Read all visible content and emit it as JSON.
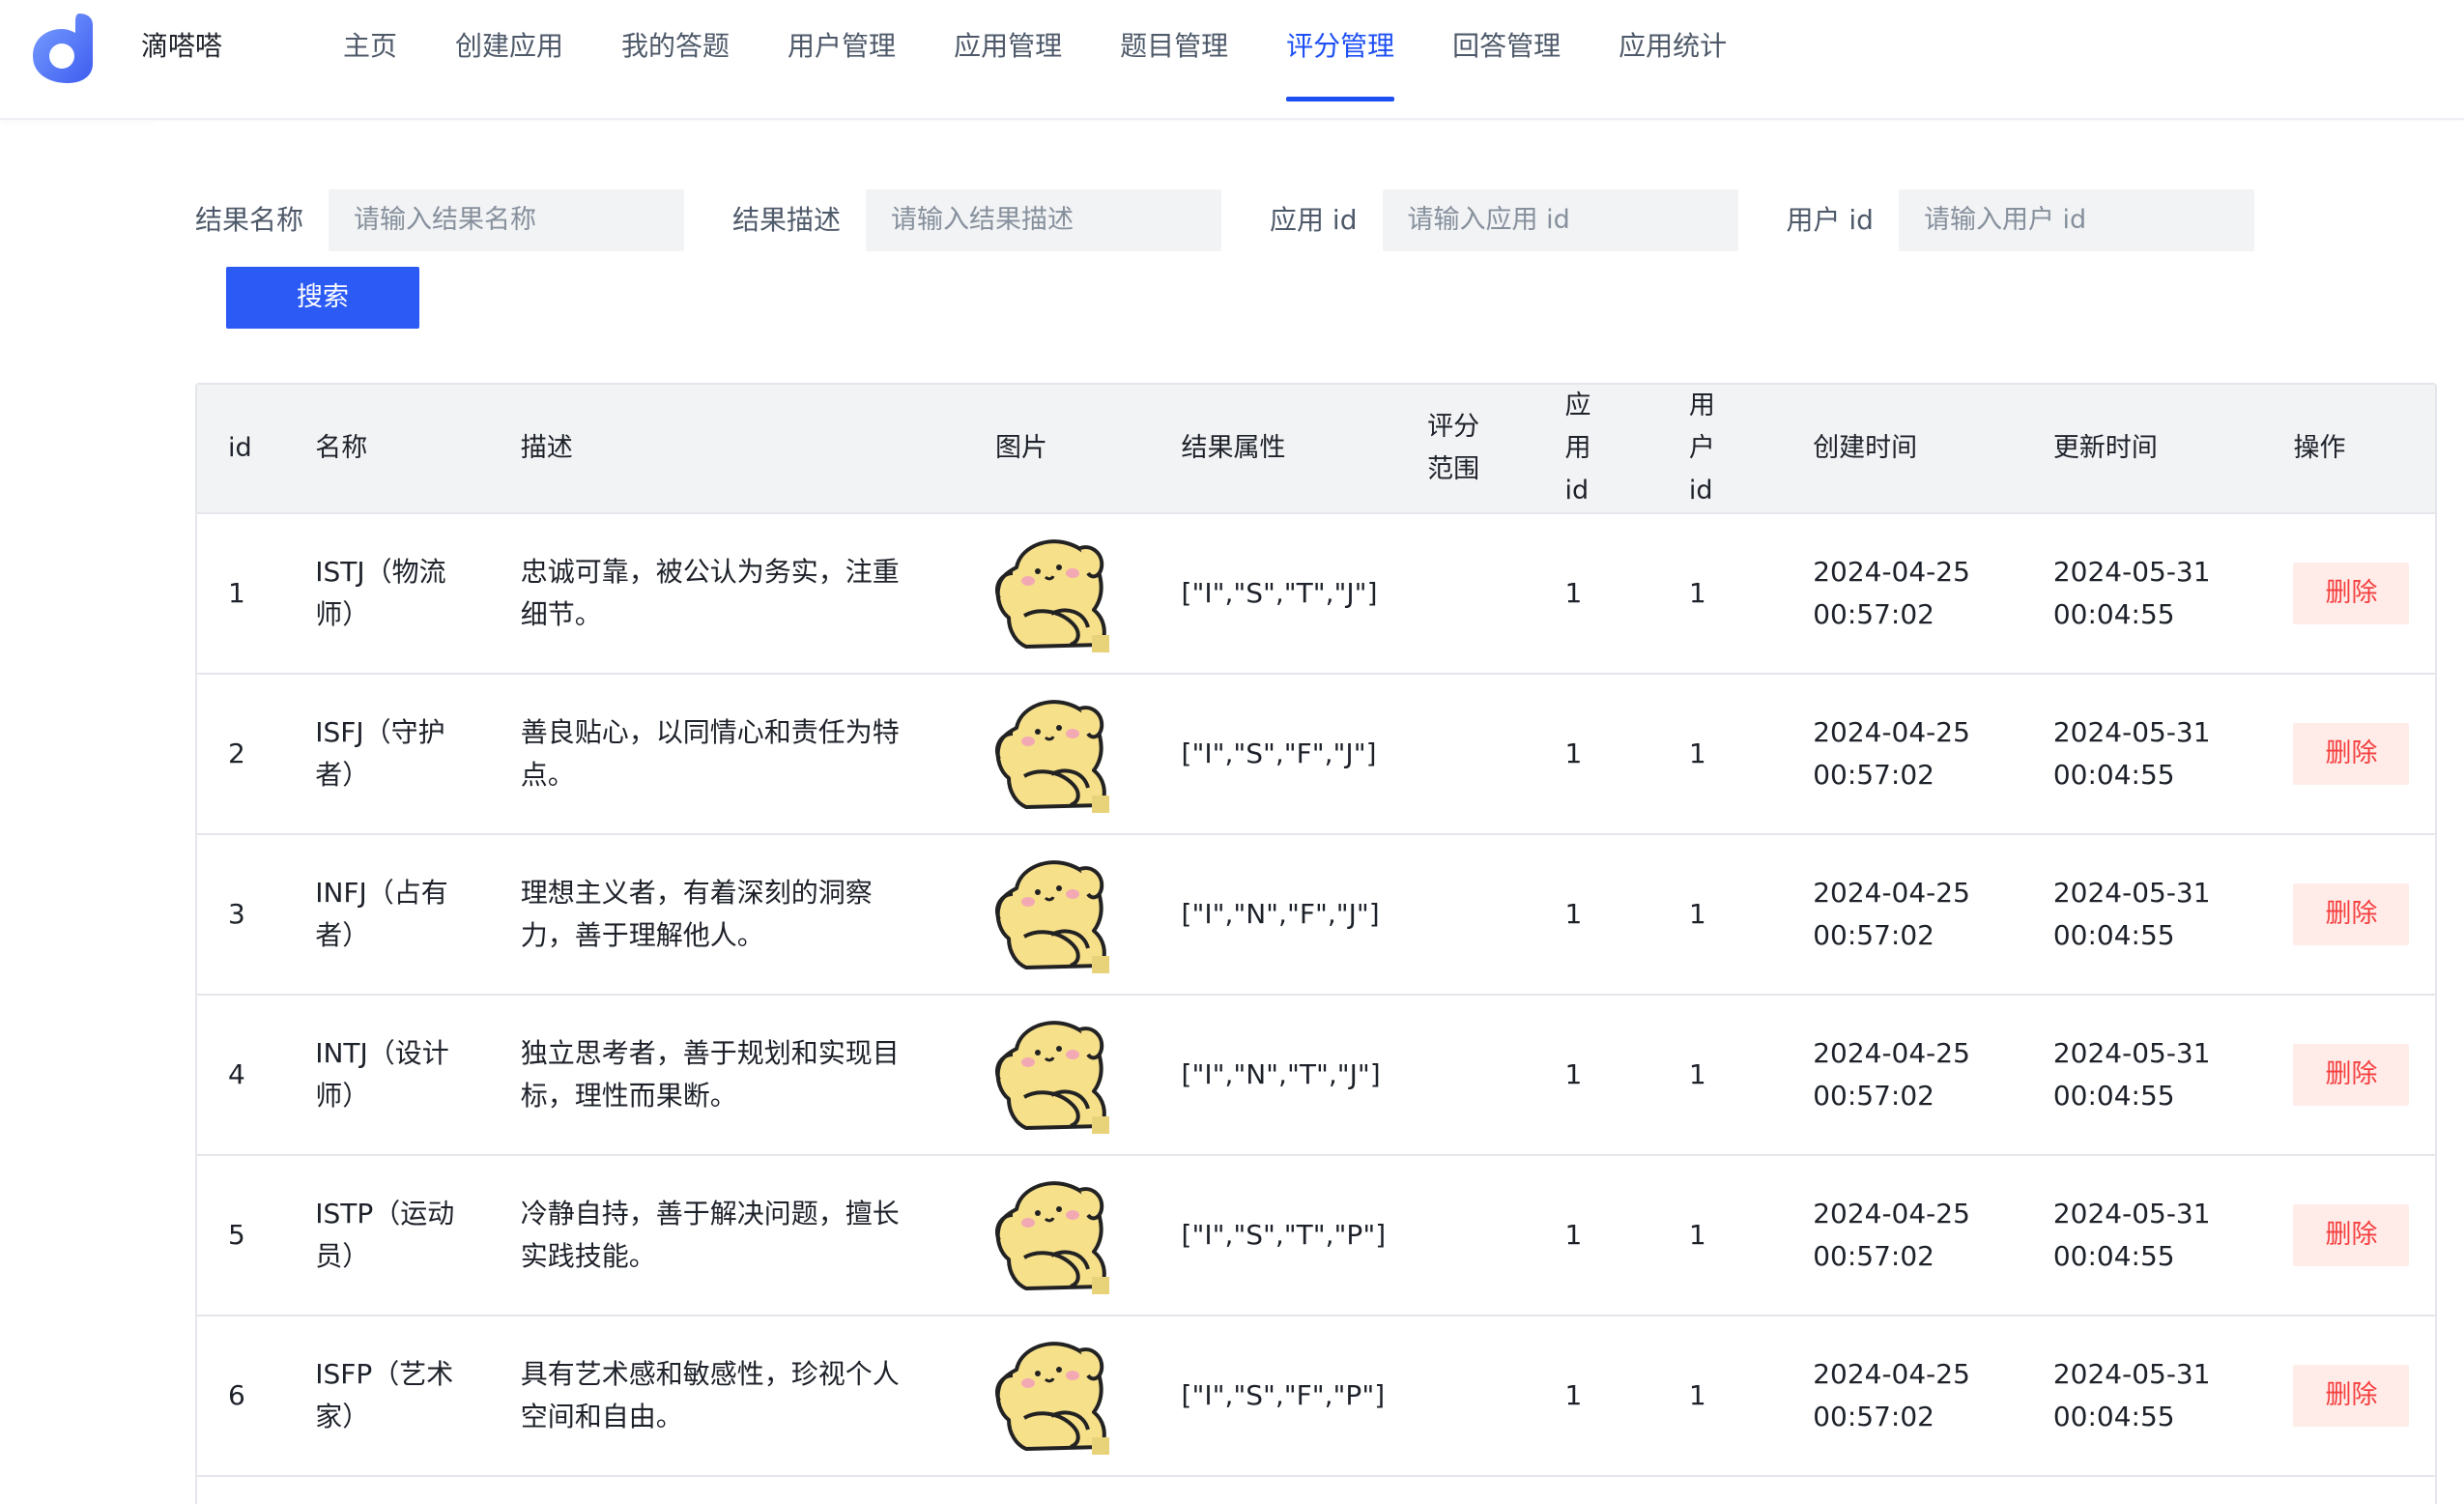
{
  "app": {
    "brand": "滴嗒嗒"
  },
  "nav": {
    "items": [
      {
        "label": "主页"
      },
      {
        "label": "创建应用"
      },
      {
        "label": "我的答题"
      },
      {
        "label": "用户管理"
      },
      {
        "label": "应用管理"
      },
      {
        "label": "题目管理"
      },
      {
        "label": "评分管理",
        "active": true
      },
      {
        "label": "回答管理"
      },
      {
        "label": "应用统计"
      }
    ]
  },
  "filters": {
    "result_name": {
      "label": "结果名称",
      "placeholder": "请输入结果名称",
      "value": ""
    },
    "result_desc": {
      "label": "结果描述",
      "placeholder": "请输入结果描述",
      "value": ""
    },
    "app_id": {
      "label": "应用 id",
      "placeholder": "请输入应用 id",
      "value": ""
    },
    "user_id": {
      "label": "用户 id",
      "placeholder": "请输入用户 id",
      "value": ""
    },
    "search_label": "搜索"
  },
  "table": {
    "headers": {
      "id": "id",
      "name": "名称",
      "desc": "描述",
      "image": "图片",
      "attrs": "结果属性",
      "score_range": "评分范围",
      "app_id": "应用id",
      "user_id": "用户id",
      "created": "创建时间",
      "updated": "更新时间",
      "ops": "操作"
    },
    "delete_label": "删除",
    "rows": [
      {
        "id": "1",
        "name": "ISTJ（物流师）",
        "desc": "忠诚可靠，被公认为务实，注重细节。",
        "attrs": "[\"I\",\"S\",\"T\",\"J\"]",
        "score_range": "",
        "app_id": "1",
        "user_id": "1",
        "created": "2024-04-25 00:57:02",
        "updated": "2024-05-31 00:04:55"
      },
      {
        "id": "2",
        "name": "ISFJ（守护者）",
        "desc": "善良贴心，以同情心和责任为特点。",
        "attrs": "[\"I\",\"S\",\"F\",\"J\"]",
        "score_range": "",
        "app_id": "1",
        "user_id": "1",
        "created": "2024-04-25 00:57:02",
        "updated": "2024-05-31 00:04:55"
      },
      {
        "id": "3",
        "name": "INFJ（占有者）",
        "desc": "理想主义者，有着深刻的洞察力，善于理解他人。",
        "attrs": "[\"I\",\"N\",\"F\",\"J\"]",
        "score_range": "",
        "app_id": "1",
        "user_id": "1",
        "created": "2024-04-25 00:57:02",
        "updated": "2024-05-31 00:04:55"
      },
      {
        "id": "4",
        "name": "INTJ（设计师）",
        "desc": "独立思考者，善于规划和实现目标，理性而果断。",
        "attrs": "[\"I\",\"N\",\"T\",\"J\"]",
        "score_range": "",
        "app_id": "1",
        "user_id": "1",
        "created": "2024-04-25 00:57:02",
        "updated": "2024-05-31 00:04:55"
      },
      {
        "id": "5",
        "name": "ISTP（运动员）",
        "desc": "冷静自持，善于解决问题，擅长实践技能。",
        "attrs": "[\"I\",\"S\",\"T\",\"P\"]",
        "score_range": "",
        "app_id": "1",
        "user_id": "1",
        "created": "2024-04-25 00:57:02",
        "updated": "2024-05-31 00:04:55"
      },
      {
        "id": "6",
        "name": "ISFP（艺术家）",
        "desc": "具有艺术感和敏感性，珍视个人空间和自由。",
        "attrs": "[\"I\",\"S\",\"F\",\"P\"]",
        "score_range": "",
        "app_id": "1",
        "user_id": "1",
        "created": "2024-04-25 00:57:02",
        "updated": "2024-05-31 00:04:55"
      }
    ]
  },
  "colors": {
    "accent": "#1d4ff5",
    "primary_button": "#2b5af5",
    "danger": "#f53f3f",
    "danger_bg": "#ffece8"
  }
}
